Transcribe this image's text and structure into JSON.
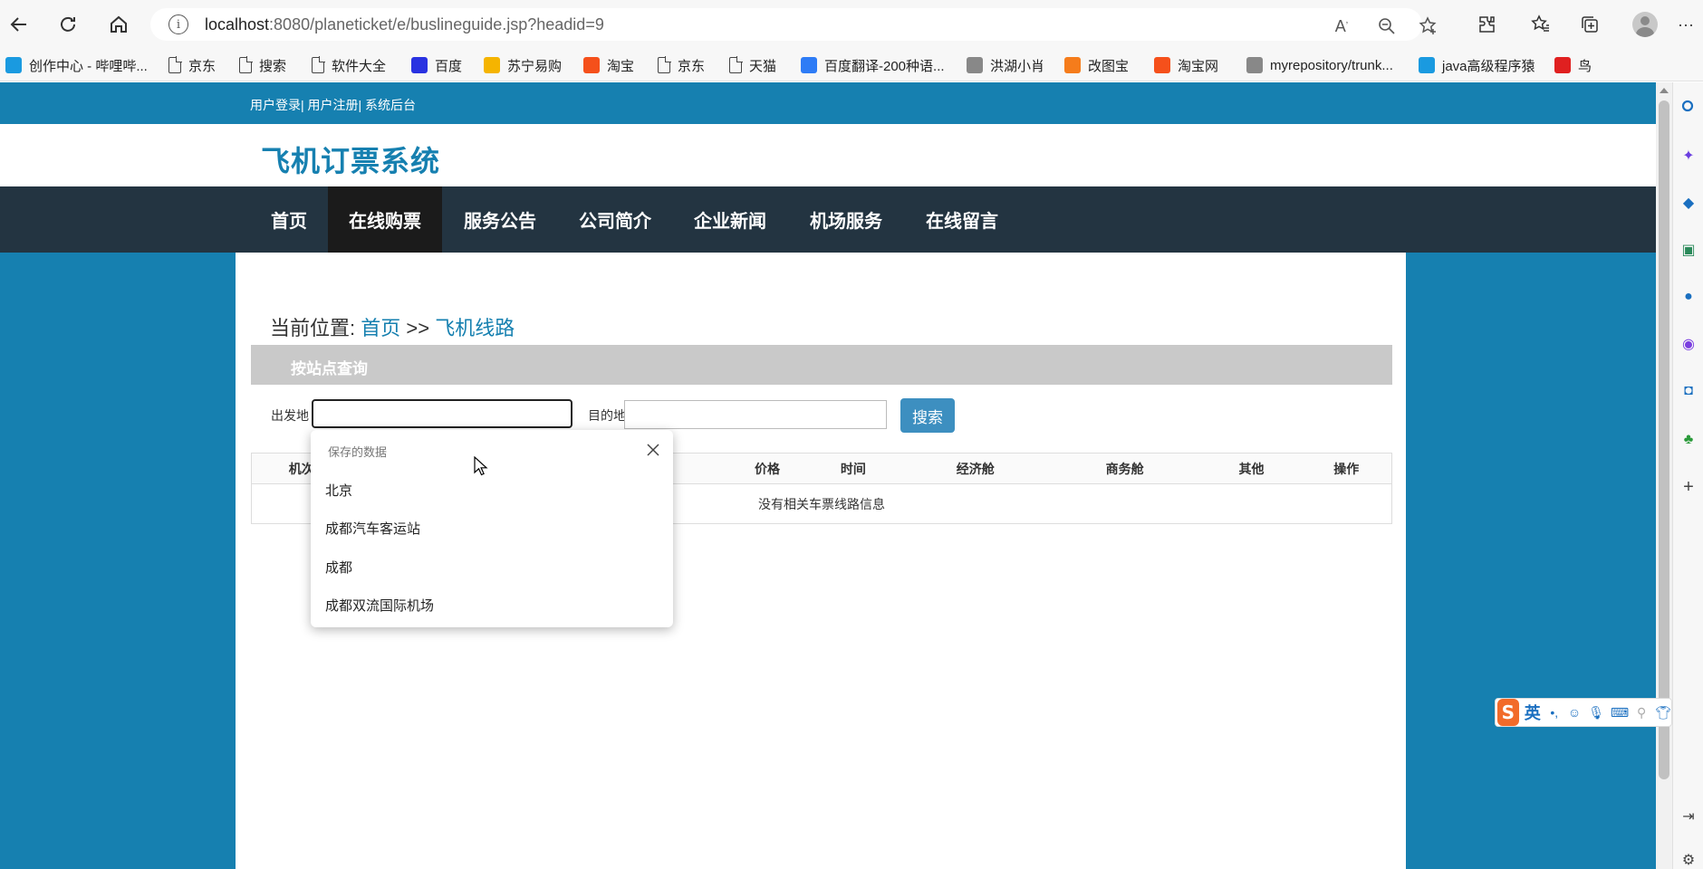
{
  "browser": {
    "url_host": "localhost",
    "url_path": ":8080/planeticket/e/buslineguide.jsp?headid=9",
    "bookmarks": [
      {
        "label": "创作中心 - 哔哩哔...",
        "icon": "bilibili-icon",
        "color": "#1a9ae0"
      },
      {
        "label": "京东",
        "icon": "page-icon"
      },
      {
        "label": "搜索",
        "icon": "page-icon"
      },
      {
        "label": "软件大全",
        "icon": "page-icon"
      },
      {
        "label": "百度",
        "icon": "baidu-icon",
        "color": "#2932e1"
      },
      {
        "label": "苏宁易购",
        "icon": "suning-icon",
        "color": "#f5b400"
      },
      {
        "label": "淘宝",
        "icon": "taobao-icon",
        "color": "#f5501b"
      },
      {
        "label": "京东",
        "icon": "page-icon"
      },
      {
        "label": "天猫",
        "icon": "page-icon"
      },
      {
        "label": "百度翻译-200种语...",
        "icon": "baidu-translate-icon",
        "color": "#2e7cf6"
      },
      {
        "label": "洪湖小肖",
        "icon": "feather-icon"
      },
      {
        "label": "改图宝",
        "icon": "gaitubao-icon",
        "color": "#f57c1b"
      },
      {
        "label": "淘宝网",
        "icon": "taobao-icon",
        "color": "#f5501b"
      },
      {
        "label": "myrepository/trunk...",
        "icon": "chrome-icon"
      },
      {
        "label": "java高级程序猿",
        "icon": "bilibili-icon",
        "color": "#1a9ae0"
      },
      {
        "label": "鸟",
        "icon": "bird-icon",
        "color": "#e02020"
      }
    ]
  },
  "site": {
    "util_links": "用户登录| 用户注册| 系统后台",
    "title": "飞机订票系统",
    "nav": [
      "首页",
      "在线购票",
      "服务公告",
      "公司简介",
      "企业新闻",
      "机场服务",
      "在线留言"
    ],
    "active_nav": "在线购票"
  },
  "breadcrumb": {
    "prefix": "当前位置:",
    "home": "首页",
    "sep": ">>",
    "current": "飞机线路"
  },
  "search": {
    "panel_title": "按站点查询",
    "from_label": "出发地",
    "to_label": "目的地",
    "from_value": "",
    "to_value": "",
    "button_label": "搜索"
  },
  "table": {
    "headers": [
      "机次",
      "价格",
      "时间",
      "经济舱",
      "商务舱",
      "其他",
      "操作"
    ],
    "empty_message": "没有相关车票线路信息"
  },
  "autofill": {
    "title": "保存的数据",
    "items": [
      "北京",
      "成都汽车客运站",
      "成都",
      "成都双流国际机场"
    ]
  },
  "ime": {
    "lang": "英"
  },
  "colors": {
    "brand_blue": "#1680b0",
    "nav_dark": "#233441",
    "nav_active": "#1b1b1b",
    "search_button": "#3d8fc0"
  }
}
